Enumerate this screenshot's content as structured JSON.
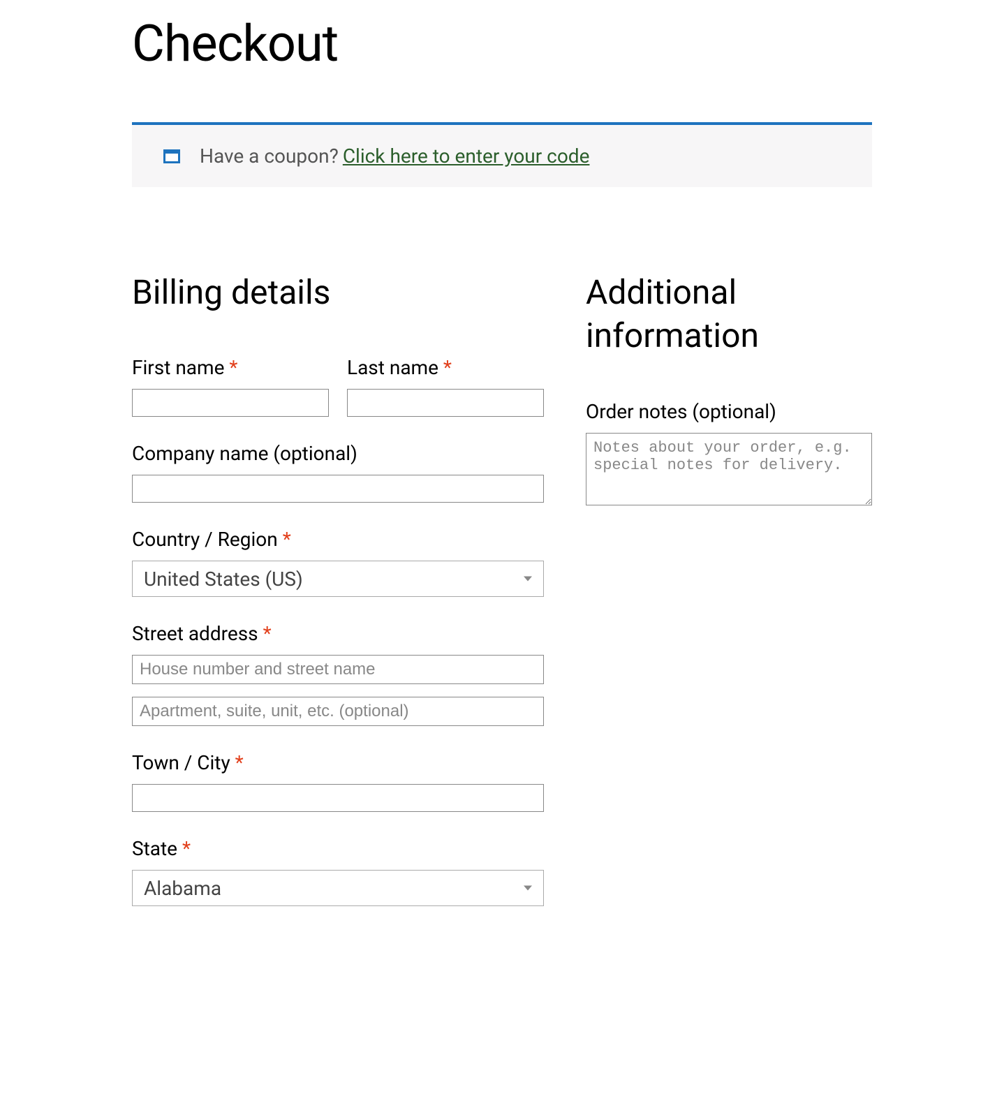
{
  "page_title": "Checkout",
  "coupon": {
    "prompt": "Have a coupon?",
    "link": "Click here to enter your code"
  },
  "billing": {
    "heading": "Billing details",
    "fields": {
      "first_name_label": "First name",
      "last_name_label": "Last name",
      "company_label": "Company name (optional)",
      "country_label": "Country / Region",
      "country_value": "United States (US)",
      "street_label": "Street address",
      "street1_placeholder": "House number and street name",
      "street2_placeholder": "Apartment, suite, unit, etc. (optional)",
      "city_label": "Town / City",
      "state_label": "State",
      "state_value": "Alabama"
    }
  },
  "additional": {
    "heading": "Additional information",
    "order_notes_label": "Order notes (optional)",
    "order_notes_placeholder": "Notes about your order, e.g. special notes for delivery."
  },
  "required_marker": "*"
}
